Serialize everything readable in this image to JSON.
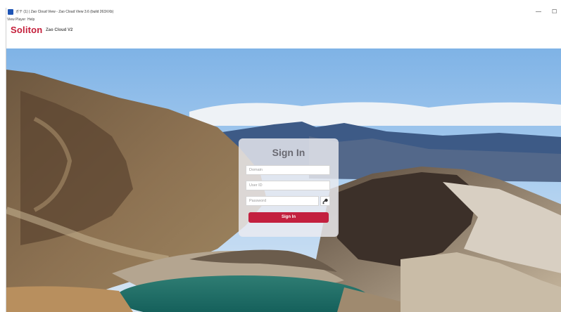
{
  "window": {
    "title": "ガテ (1) | Zao Cloud View - Zao Cloud View 3.6 (build 263XXb)",
    "minimize_glyph": "—",
    "maximize_glyph": "☐"
  },
  "menu": {
    "items": [
      "View",
      "Player",
      "Help"
    ]
  },
  "brand": {
    "logo": "Soliton",
    "product": "Zao Cloud V2",
    "color": "#c41e3a"
  },
  "signin": {
    "title": "Sign In",
    "domain_placeholder": "Domain",
    "userid_placeholder": "User ID",
    "password_placeholder": "Password",
    "key_icon": "key-icon",
    "button_label": "Sign In",
    "button_color": "#c3203f"
  }
}
